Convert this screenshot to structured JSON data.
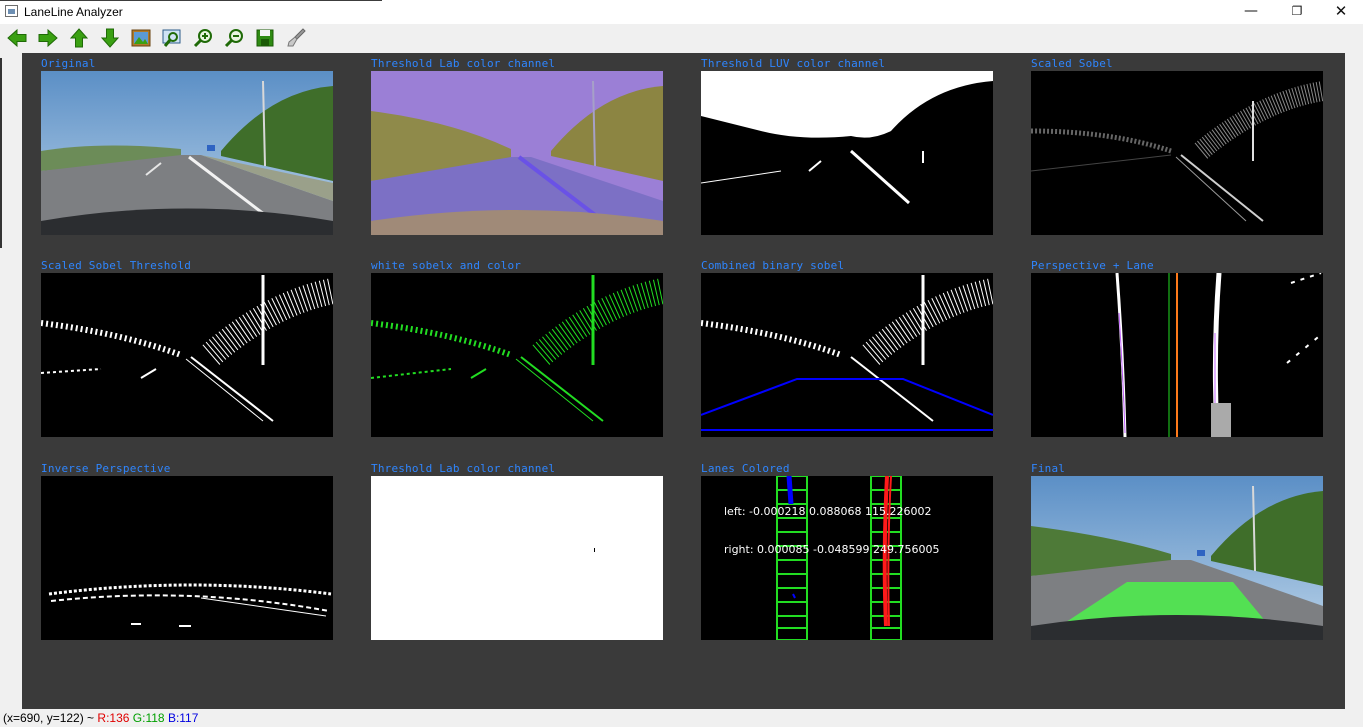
{
  "window": {
    "title": "LaneLine Analyzer",
    "minimize_glyph": "—",
    "restore_glyph": "❐",
    "close_glyph": "✕"
  },
  "toolbar": {
    "buttons": [
      {
        "name": "pan-left",
        "icon": "arrow-left-icon"
      },
      {
        "name": "pan-right",
        "icon": "arrow-right-icon"
      },
      {
        "name": "pan-up",
        "icon": "arrow-up-icon"
      },
      {
        "name": "pan-down",
        "icon": "arrow-down-icon"
      },
      {
        "name": "zoom-image",
        "icon": "image-icon"
      },
      {
        "name": "zoom-region",
        "icon": "zoom-region-icon"
      },
      {
        "name": "zoom-in",
        "icon": "zoom-in-icon"
      },
      {
        "name": "zoom-out",
        "icon": "zoom-out-icon"
      },
      {
        "name": "save",
        "icon": "save-icon"
      },
      {
        "name": "properties",
        "icon": "brush-icon"
      }
    ]
  },
  "tiles": [
    {
      "label": "Original"
    },
    {
      "label": "Threshold Lab color channel"
    },
    {
      "label": "Threshold LUV color channel"
    },
    {
      "label": "Scaled Sobel"
    },
    {
      "label": "Scaled Sobel Threshold"
    },
    {
      "label": "white sobelx and color"
    },
    {
      "label": "Combined binary sobel"
    },
    {
      "label": "Perspective + Lane"
    },
    {
      "label": "Inverse Perspective"
    },
    {
      "label": "Threshold Lab color channel"
    },
    {
      "label": "Lanes Colored",
      "left_text": "left: -0.000218  0.088068 115.226002",
      "right_text": "right: 0.000085  -0.048599 249.756005"
    },
    {
      "label": "Final"
    }
  ],
  "status": {
    "coords": "(x=690, y=122) ~",
    "r": "R:136",
    "g": "G:118",
    "b": "B:117"
  },
  "colors": {
    "label": "#2f86ff",
    "canvas": "#3a3a3a",
    "lane_green": "#22dd22",
    "lane_blue": "#0000ff"
  }
}
